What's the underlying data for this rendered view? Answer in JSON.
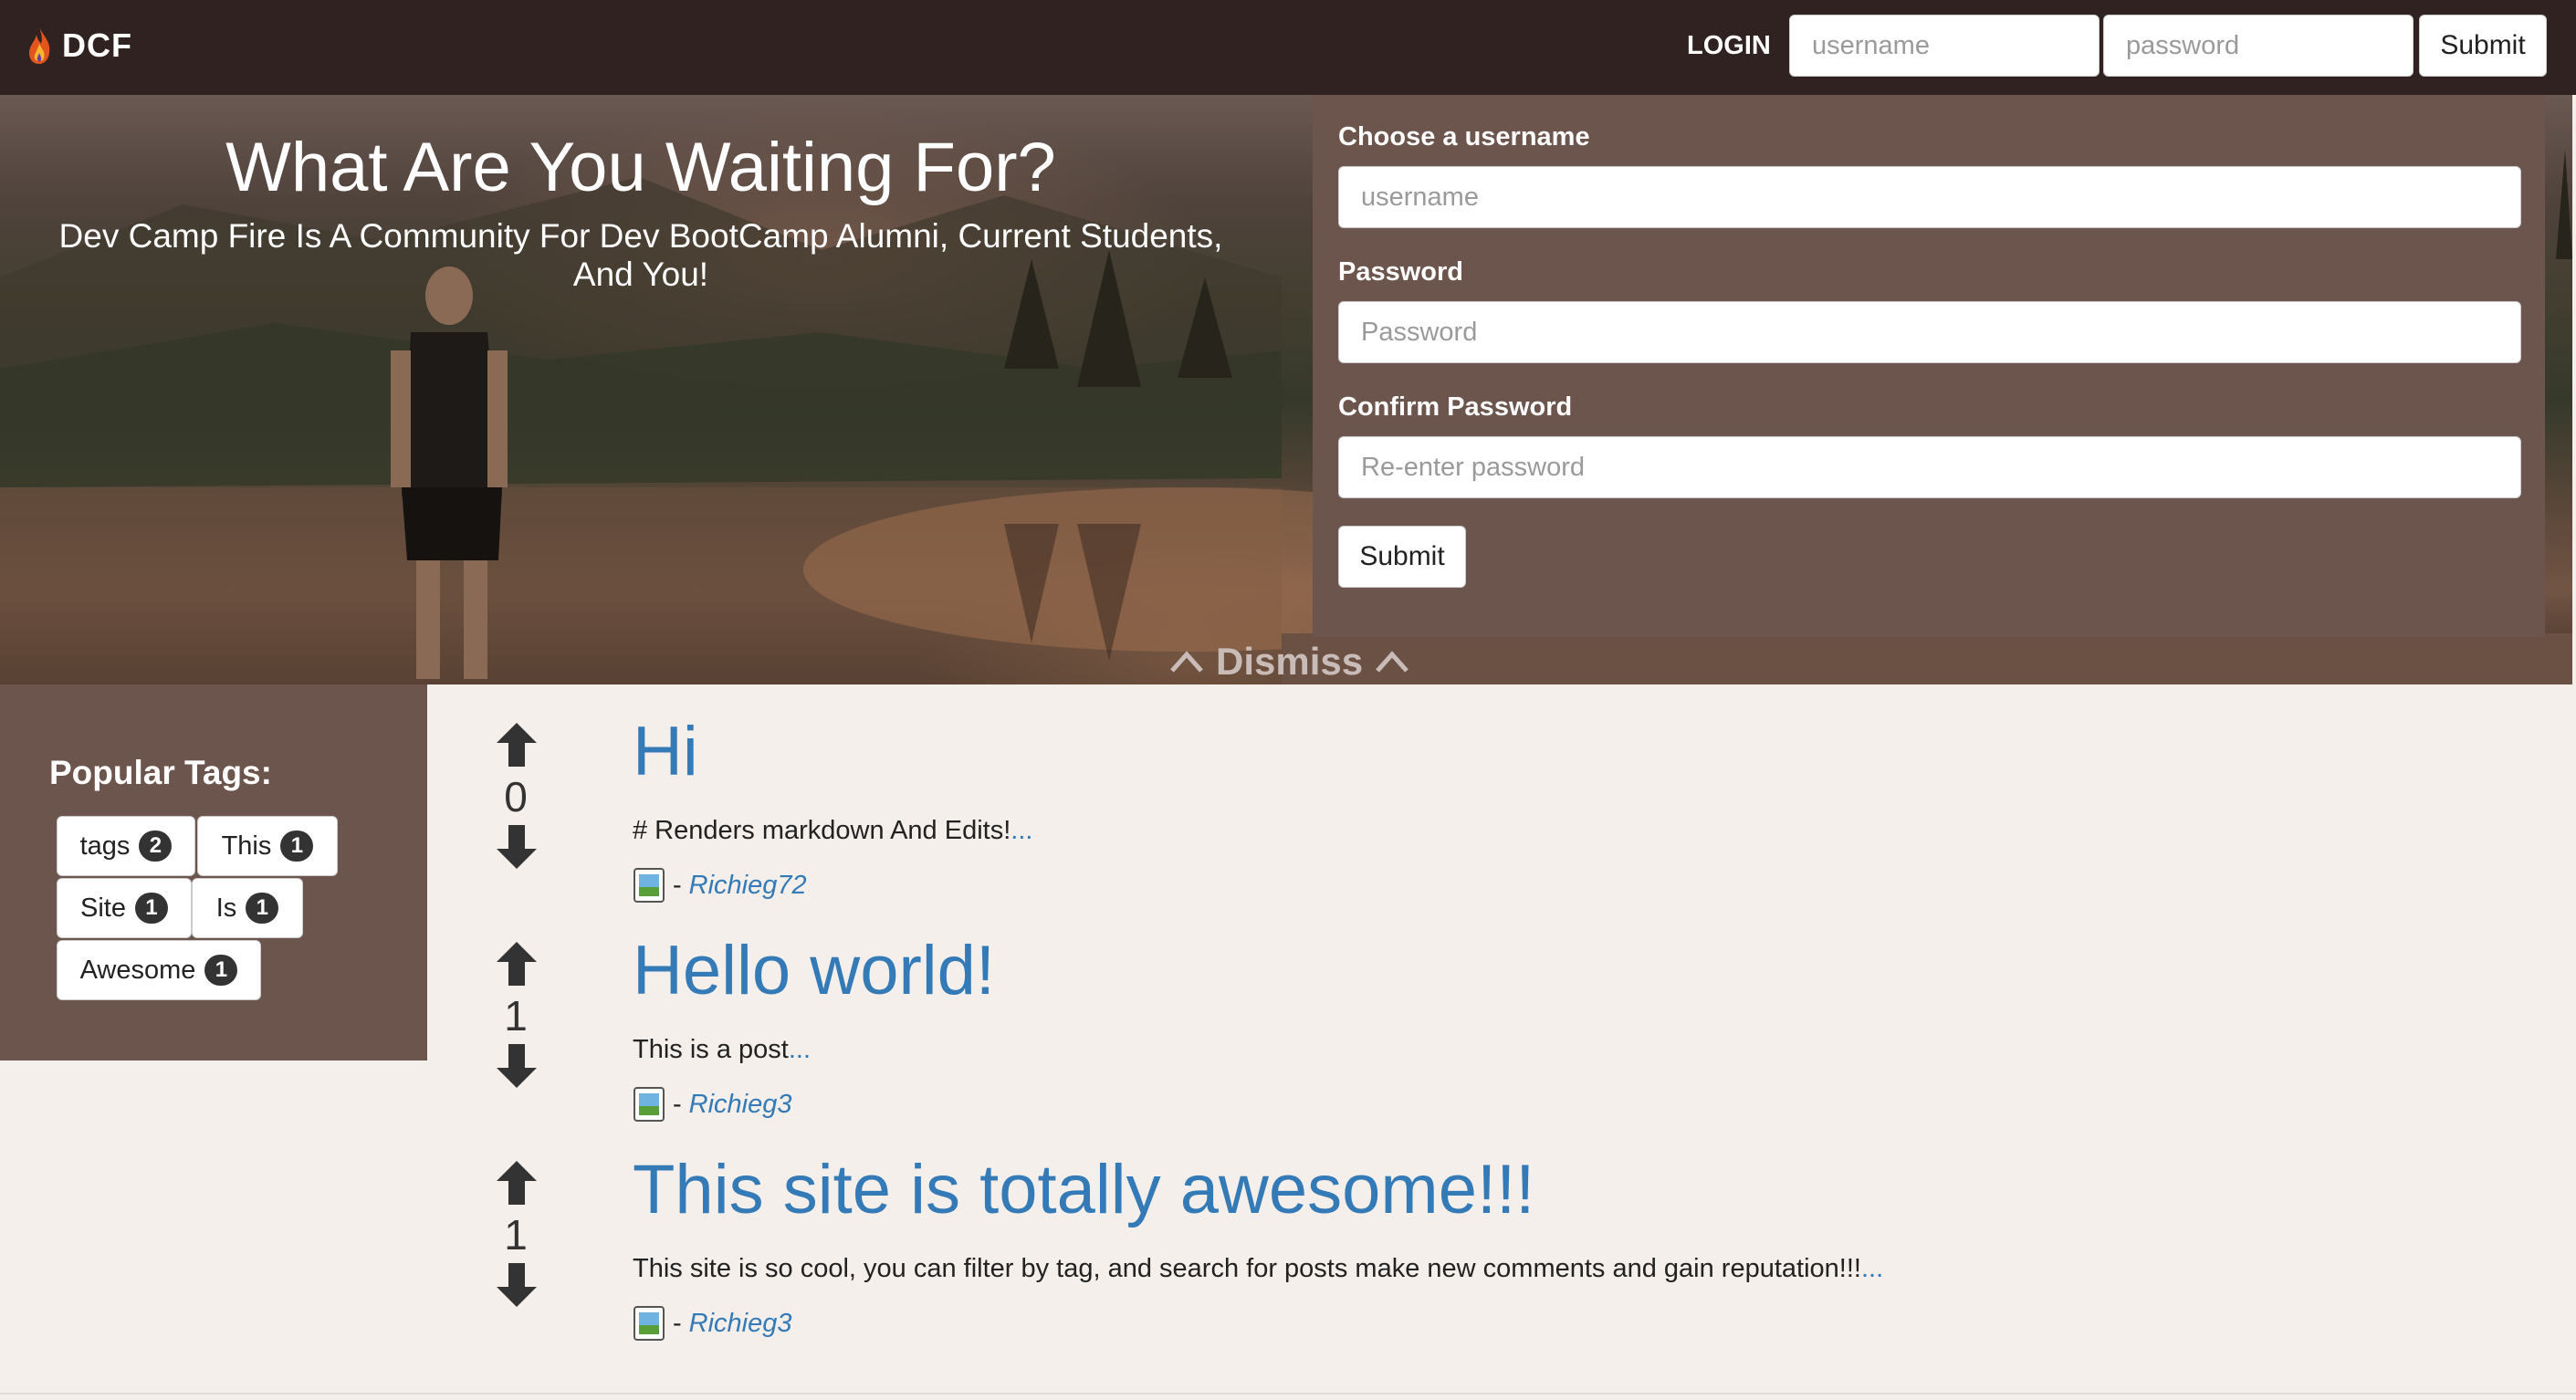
{
  "navbar": {
    "brand": "DCF",
    "login_label": "LOGIN",
    "username_placeholder": "username",
    "password_placeholder": "password",
    "submit_label": "Submit"
  },
  "hero": {
    "title": "What Are You Waiting For?",
    "subtitle": "Dev Camp Fire Is A Community For Dev BootCamp Alumni, Current Students, And You!"
  },
  "signup": {
    "username_label": "Choose a username",
    "username_placeholder": "username",
    "password_label": "Password",
    "password_placeholder": "Password",
    "confirm_label": "Confirm Password",
    "confirm_placeholder": "Re-enter password",
    "submit_label": "Submit",
    "dismiss_label": "Dismiss"
  },
  "sidebar": {
    "title": "Popular Tags:",
    "tags": [
      {
        "name": "tags",
        "count": "2"
      },
      {
        "name": "This",
        "count": "1"
      },
      {
        "name": "Site",
        "count": "1"
      },
      {
        "name": "Is",
        "count": "1"
      },
      {
        "name": "Awesome",
        "count": "1"
      }
    ]
  },
  "posts": [
    {
      "title": "Hi",
      "votes": "0",
      "excerpt": "# Renders markdown And Edits!",
      "more": "...",
      "separator": "-",
      "author": "Richieg72"
    },
    {
      "title": "Hello world!",
      "votes": "1",
      "excerpt": "This is a post",
      "more": "...",
      "separator": "-",
      "author": "Richieg3"
    },
    {
      "title": "This site is totally awesome!!!",
      "votes": "1",
      "excerpt": "This site is so cool, you can filter by tag, and search for posts make new comments and gain reputation!!!",
      "more": "...",
      "separator": "-",
      "author": "Richieg3"
    }
  ],
  "colors": {
    "navbar_bg": "#2f2220",
    "panel_bg": "#6b554d",
    "page_bg": "#f4efeb",
    "link": "#337ab7"
  }
}
